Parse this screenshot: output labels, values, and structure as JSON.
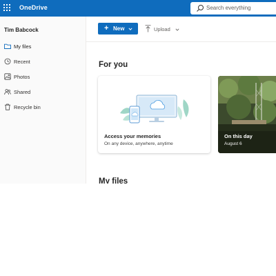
{
  "app": {
    "brand": "OneDrive"
  },
  "search": {
    "placeholder": "Search everything"
  },
  "sidebar": {
    "user": "Tim Babcock",
    "items": [
      {
        "label": "My files",
        "icon": "folder-icon",
        "active": true
      },
      {
        "label": "Recent",
        "icon": "clock-icon",
        "active": false
      },
      {
        "label": "Photos",
        "icon": "image-icon",
        "active": false
      },
      {
        "label": "Shared",
        "icon": "people-icon",
        "active": false
      },
      {
        "label": "Recycle bin",
        "icon": "trash-icon",
        "active": false
      }
    ]
  },
  "commands": {
    "new_label": "New",
    "upload_label": "Upload"
  },
  "sections": {
    "for_you": "For you",
    "my_files": "My files"
  },
  "cards": [
    {
      "title": "Access your memories",
      "subtitle": "On any device, anywhere, anytime"
    },
    {
      "title": "On this day",
      "subtitle": "August 6"
    }
  ],
  "colors": {
    "accent": "#0f6cbd",
    "sidebar_bg": "#fafafa"
  }
}
